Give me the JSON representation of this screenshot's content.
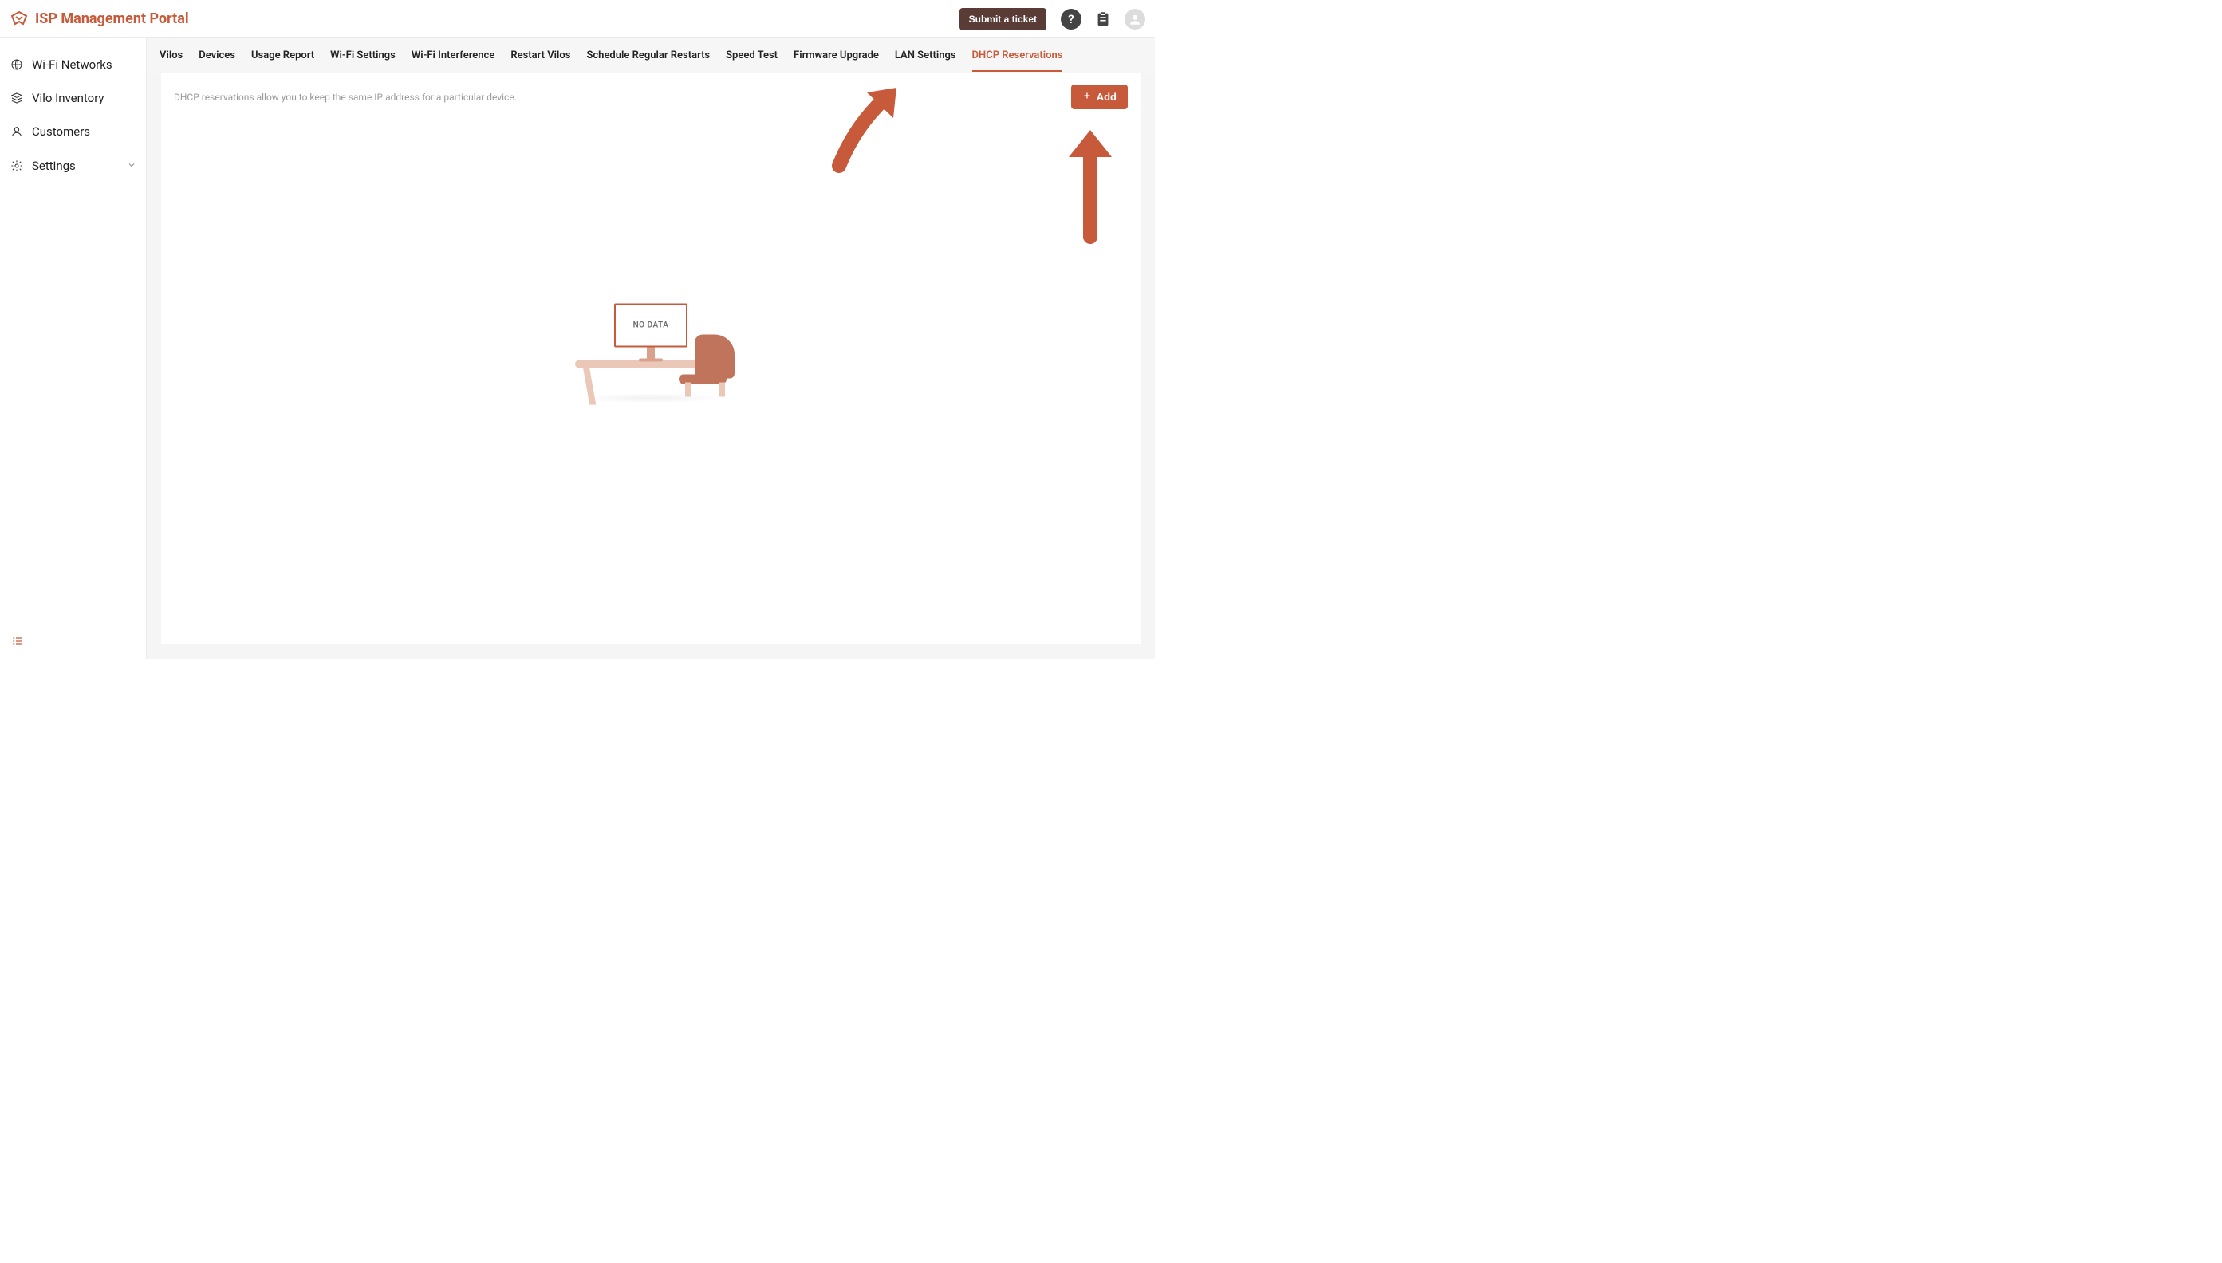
{
  "header": {
    "title": "ISP Management Portal",
    "submit_ticket": "Submit a ticket"
  },
  "sidebar": {
    "items": [
      {
        "label": "Wi-Fi Networks",
        "icon": "globe-icon"
      },
      {
        "label": "Vilo Inventory",
        "icon": "layers-icon"
      },
      {
        "label": "Customers",
        "icon": "user-icon"
      },
      {
        "label": "Settings",
        "icon": "gear-icon",
        "expandable": true
      }
    ]
  },
  "tabs": {
    "items": [
      {
        "label": "Vilos",
        "active": false
      },
      {
        "label": "Devices",
        "active": false
      },
      {
        "label": "Usage Report",
        "active": false
      },
      {
        "label": "Wi-Fi Settings",
        "active": false
      },
      {
        "label": "Wi-Fi Interference",
        "active": false
      },
      {
        "label": "Restart Vilos",
        "active": false
      },
      {
        "label": "Schedule Regular Restarts",
        "active": false
      },
      {
        "label": "Speed Test",
        "active": false
      },
      {
        "label": "Firmware Upgrade",
        "active": false
      },
      {
        "label": "LAN Settings",
        "active": false
      },
      {
        "label": "DHCP Reservations",
        "active": true
      }
    ]
  },
  "content": {
    "description": "DHCP reservations allow you to keep the same IP address for a particular device.",
    "add_button": "Add",
    "empty_state_text": "NO DATA"
  },
  "colors": {
    "accent": "#c75a3a"
  }
}
